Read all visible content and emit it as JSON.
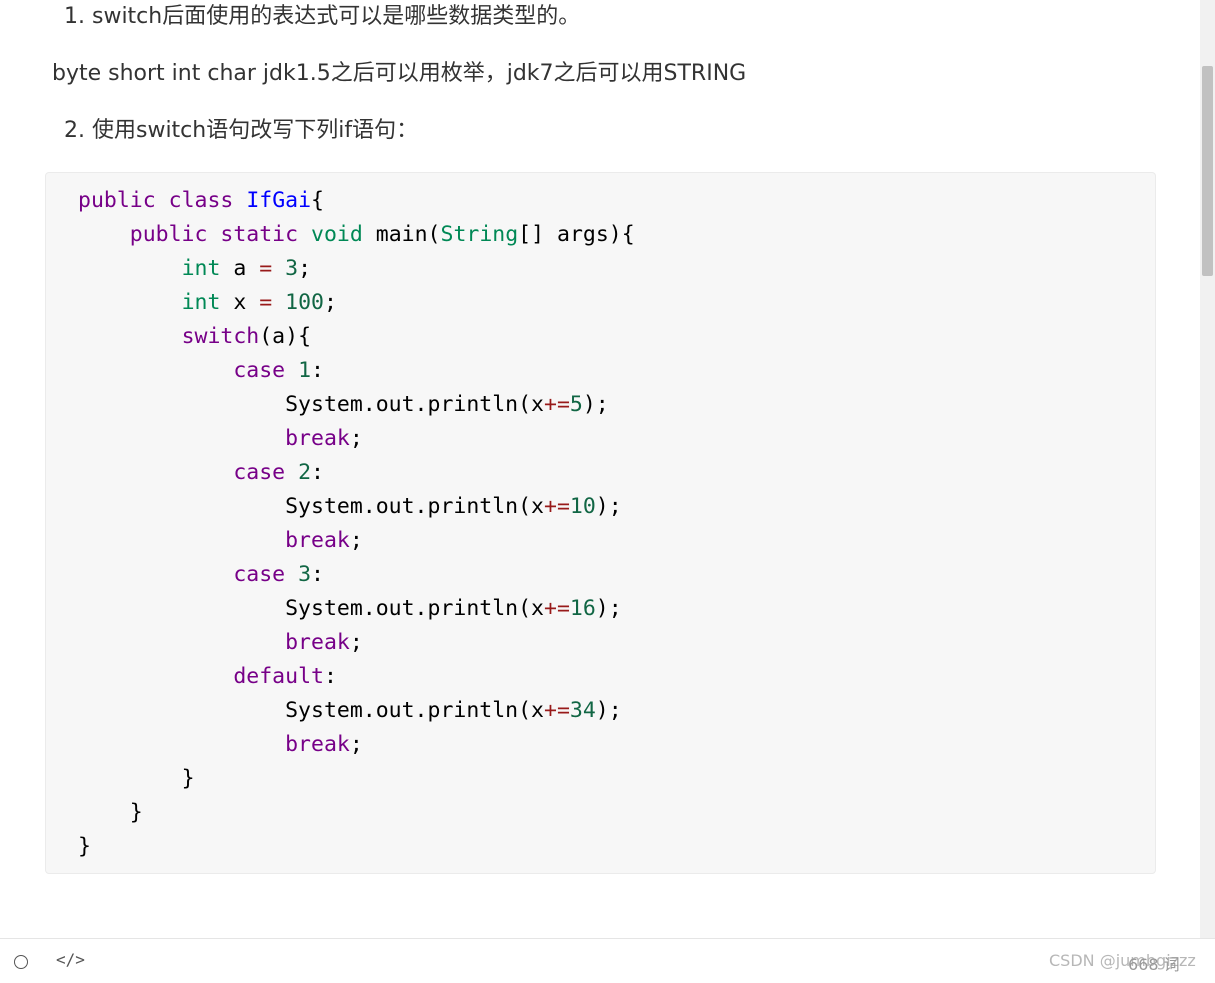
{
  "article": {
    "q1": "1. switch后面使用的表达式可以是哪些数据类型的。",
    "answer1": "byte short int char jdk1.5之后可以用枚举，jdk7之后可以用STRING",
    "q2": "2. 使用switch语句改写下列if语句："
  },
  "code": {
    "l1": {
      "t1": "public",
      "t2": "class",
      "t3": "IfGai",
      "t4": "{"
    },
    "l2": {
      "t1": "public",
      "t2": "static",
      "t3": "void",
      "t4": "main(",
      "t5": "String",
      "t6": "[] args){"
    },
    "l3": {
      "t1": "int",
      "t2": "a",
      "t3": "=",
      "t4": "3",
      "t5": ";"
    },
    "l4": {
      "t1": "int",
      "t2": "x",
      "t3": "=",
      "t4": "100",
      "t5": ";"
    },
    "l5": {
      "t1": "switch",
      "t2": "(a){"
    },
    "l6": {
      "t1": "case",
      "t2": "1",
      "t3": ":"
    },
    "l7": {
      "t1": "System.out.println(x",
      "t2": "+=",
      "t3": "5",
      "t4": ");"
    },
    "l8": {
      "t1": "break",
      "t2": ";"
    },
    "l9": {
      "t1": "case",
      "t2": "2",
      "t3": ":"
    },
    "l10": {
      "t1": "System.out.println(x",
      "t2": "+=",
      "t3": "10",
      "t4": ");"
    },
    "l11": {
      "t1": "break",
      "t2": ";"
    },
    "l12": {
      "t1": "case",
      "t2": "3",
      "t3": ":"
    },
    "l13": {
      "t1": "System.out.println(x",
      "t2": "+=",
      "t3": "16",
      "t4": ");"
    },
    "l14": {
      "t1": "break",
      "t2": ";"
    },
    "l15": {
      "t1": "default",
      "t2": ":"
    },
    "l16": {
      "t1": "System.out.println(x",
      "t2": "+=",
      "t3": "34",
      "t4": ");"
    },
    "l17": {
      "t1": "break",
      "t2": ";"
    },
    "l18": {
      "t1": "}"
    },
    "l19": {
      "t1": "}"
    },
    "l20": {
      "t1": "}"
    }
  },
  "bottom_bar": {
    "circle_icon": "circle-icon",
    "code_icon_glyph": "</>",
    "word_count": "668 词",
    "watermark": "CSDN @jumbgizzz"
  },
  "colors": {
    "keyword": "#770088",
    "type": "#008855",
    "definition": "#0000ff",
    "number": "#116644",
    "operator": "#981a1a",
    "code_bg": "#f7f7f7"
  }
}
